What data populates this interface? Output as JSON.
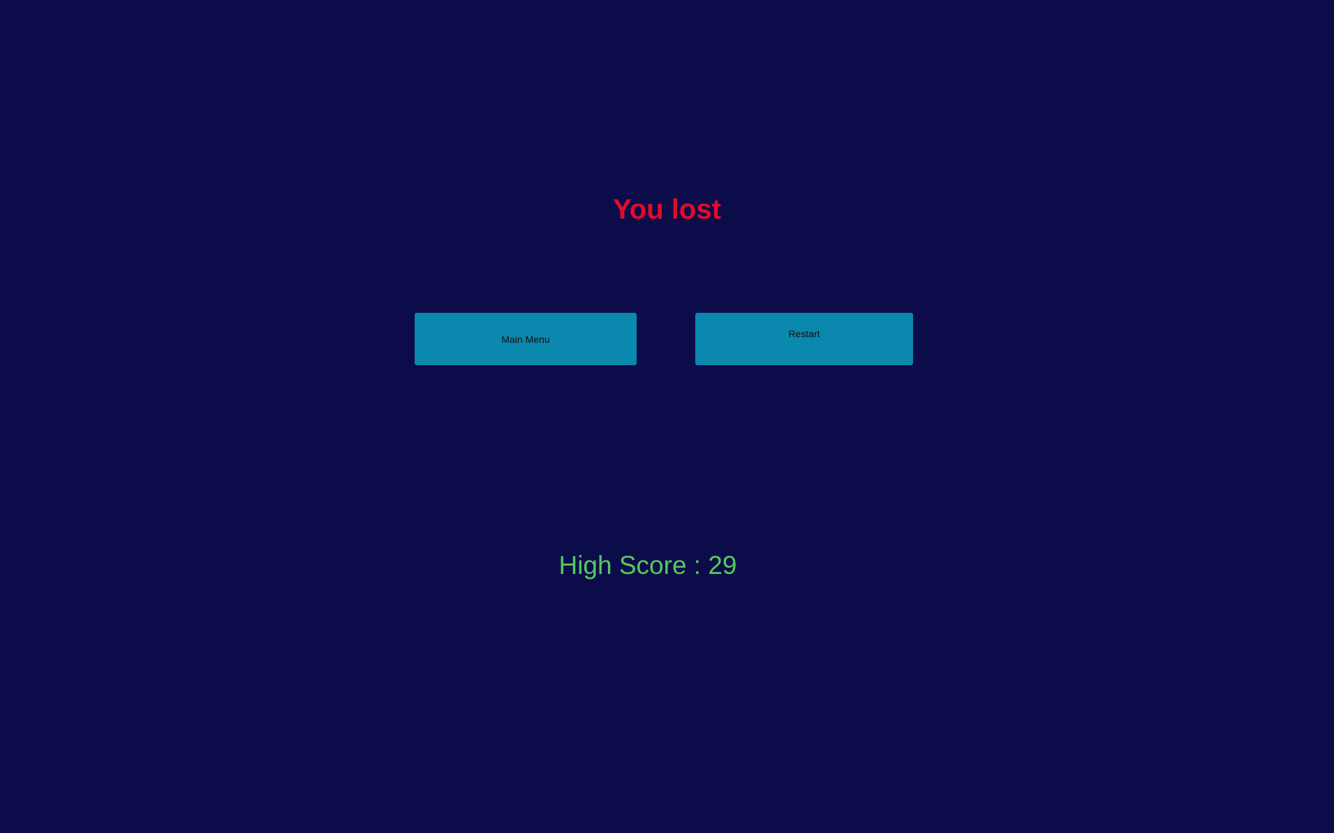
{
  "game_over": {
    "title": "You lost",
    "buttons": {
      "main_menu": "Main Menu",
      "restart": "Restart"
    },
    "high_score_text": "High Score : 29"
  },
  "colors": {
    "background": "#0d0c4b",
    "title": "#e20c28",
    "button": "#0b88ae",
    "high_score": "#55c95d"
  }
}
